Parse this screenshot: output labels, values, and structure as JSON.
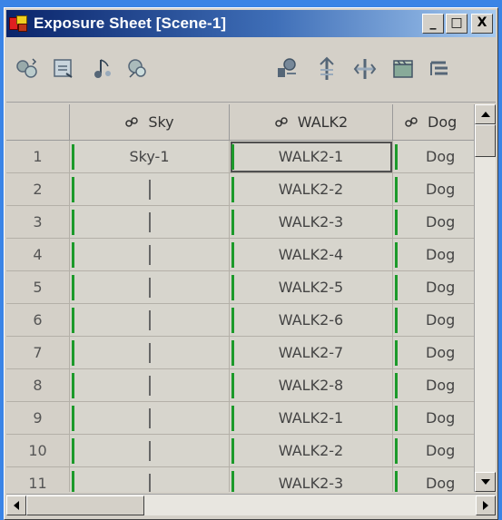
{
  "window": {
    "title": "Exposure Sheet [Scene-1]",
    "controls": {
      "minimize": "_",
      "maximize": "□",
      "close": "X"
    }
  },
  "toolbar": {
    "left_icons": [
      "add-column-icon",
      "export-icon",
      "sound-icon",
      "column-add-icon"
    ],
    "right_icons": [
      "insert-icon",
      "increase-icon",
      "decrease-icon",
      "clapper-icon",
      "menu-icon"
    ]
  },
  "columns": [
    {
      "header": "Sky",
      "icon": "drawing-column-icon"
    },
    {
      "header": "WALK2",
      "icon": "drawing-column-icon"
    },
    {
      "header": "Dog",
      "icon": "drawing-column-icon"
    }
  ],
  "rows": [
    {
      "frame": "1",
      "cells": [
        "Sky-1",
        "WALK2-1",
        "Dog"
      ]
    },
    {
      "frame": "2",
      "cells": [
        "",
        "WALK2-2",
        "Dog"
      ]
    },
    {
      "frame": "3",
      "cells": [
        "",
        "WALK2-3",
        "Dog"
      ]
    },
    {
      "frame": "4",
      "cells": [
        "",
        "WALK2-4",
        "Dog"
      ]
    },
    {
      "frame": "5",
      "cells": [
        "",
        "WALK2-5",
        "Dog"
      ]
    },
    {
      "frame": "6",
      "cells": [
        "",
        "WALK2-6",
        "Dog"
      ]
    },
    {
      "frame": "7",
      "cells": [
        "",
        "WALK2-7",
        "Dog"
      ]
    },
    {
      "frame": "8",
      "cells": [
        "",
        "WALK2-8",
        "Dog"
      ]
    },
    {
      "frame": "9",
      "cells": [
        "",
        "WALK2-1",
        "Dog"
      ]
    },
    {
      "frame": "10",
      "cells": [
        "",
        "WALK2-2",
        "Dog"
      ]
    },
    {
      "frame": "11",
      "cells": [
        "",
        "WALK2-3",
        "Dog"
      ]
    }
  ],
  "colors": {
    "title_start": "#0a246a",
    "title_end": "#a6caf0",
    "exposure_bar": "#1c9a2a",
    "desktop": "#3a84e6"
  }
}
